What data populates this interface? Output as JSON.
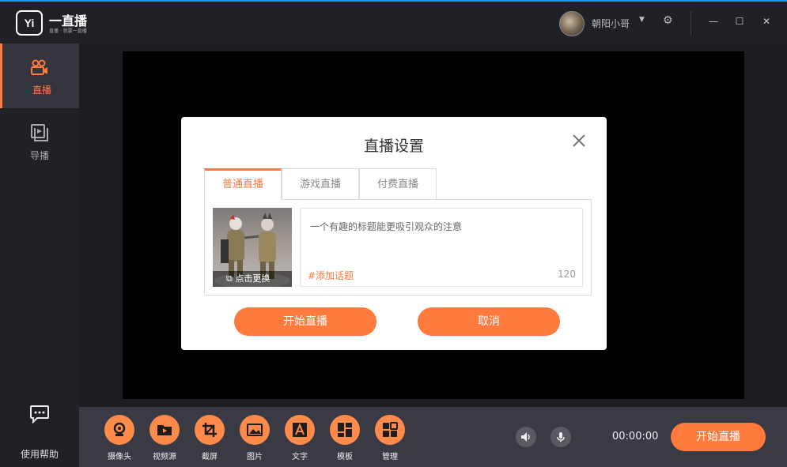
{
  "app": {
    "logo_mark": "Yi",
    "name": "一直播",
    "tagline": "直播 · 就要一直播"
  },
  "user": {
    "name": "朝阳小哥"
  },
  "sidebar": {
    "items": [
      {
        "label": "直播",
        "icon": "camera-icon",
        "active": true
      },
      {
        "label": "导播",
        "icon": "play-screen-icon",
        "active": false
      }
    ],
    "help_label": "使用帮助"
  },
  "dialog": {
    "title": "直播设置",
    "tabs": [
      {
        "label": "普通直播",
        "active": true
      },
      {
        "label": "游戏直播",
        "active": false
      },
      {
        "label": "付费直播",
        "active": false
      }
    ],
    "cover_label": "点击更换",
    "title_placeholder": "一个有趣的标题能更吸引观众的注意",
    "add_topic": "#添加话题",
    "char_limit": "120",
    "start_label": "开始直播",
    "cancel_label": "取消"
  },
  "toolbar": {
    "tools": [
      {
        "label": "摄像头",
        "icon": "webcam-icon"
      },
      {
        "label": "视频源",
        "icon": "video-folder-icon"
      },
      {
        "label": "截屏",
        "icon": "crop-icon"
      },
      {
        "label": "图片",
        "icon": "image-icon"
      },
      {
        "label": "文字",
        "icon": "text-icon"
      },
      {
        "label": "模板",
        "icon": "template-icon"
      },
      {
        "label": "管理",
        "icon": "manage-icon"
      }
    ],
    "timer": "00:00:00",
    "start_label": "开始直播"
  },
  "colors": {
    "accent": "#ff7a3d",
    "topbar_line": "#1e90ff",
    "chrome": "#202026"
  }
}
